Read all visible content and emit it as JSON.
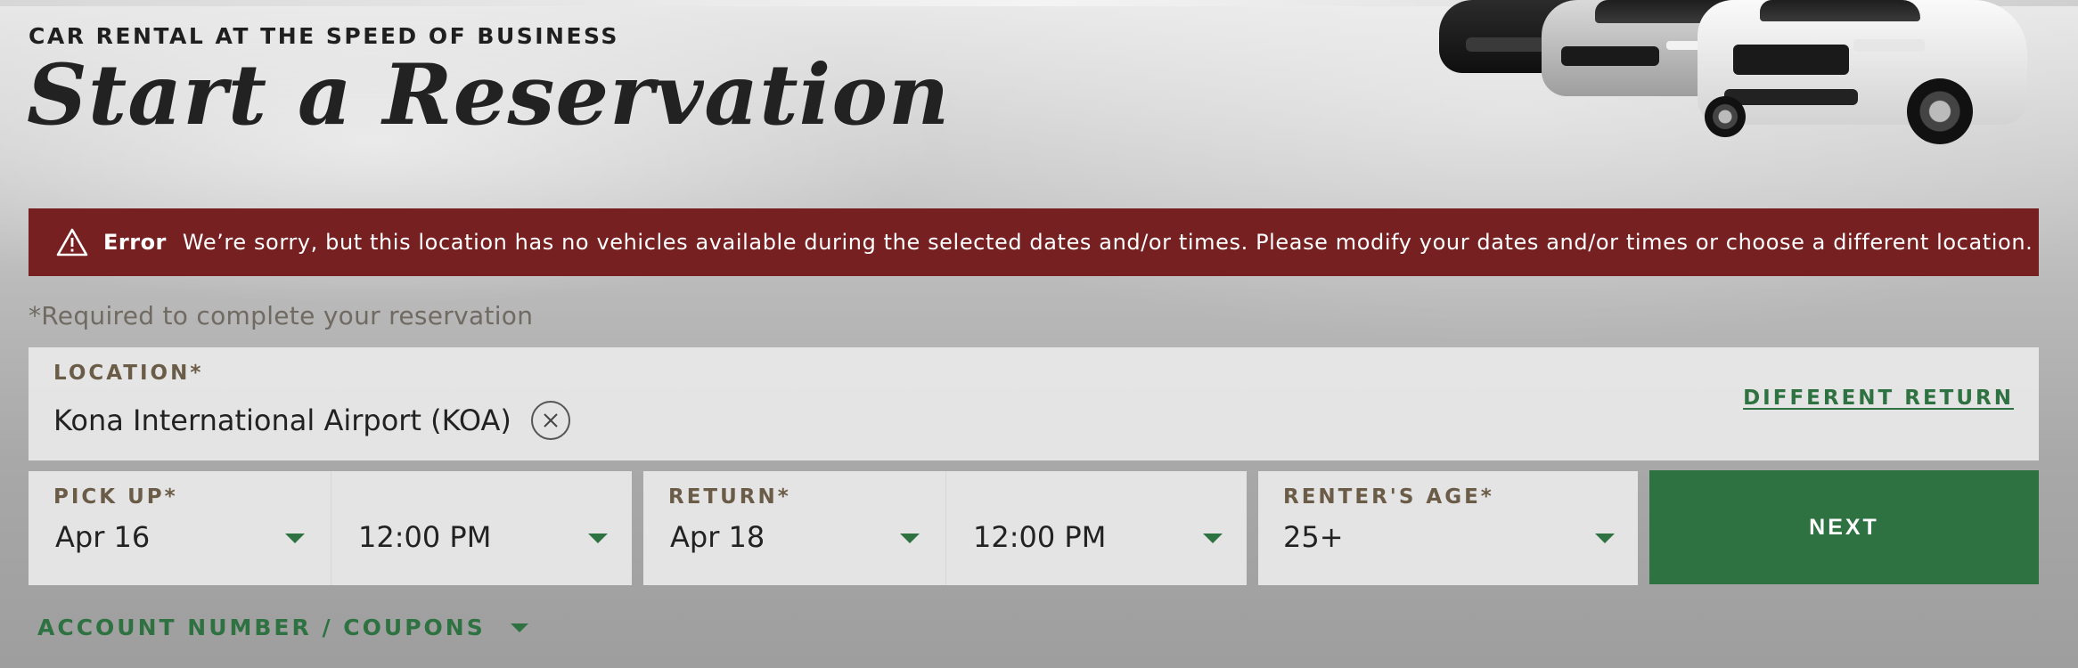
{
  "header": {
    "eyebrow": "CAR RENTAL AT THE SPEED OF BUSINESS",
    "title": "Start a Reservation"
  },
  "error": {
    "label": "Error",
    "message": "We’re sorry, but this location has no vehicles available during the selected dates and/or times. Please modify your dates and/or times or choose a different location.",
    "icon": "warning-triangle-icon",
    "color": "#772021"
  },
  "form": {
    "required_note": "*Required to complete your reservation",
    "location": {
      "label": "LOCATION*",
      "value": "Kona International Airport (KOA)",
      "different_return": "DIFFERENT RETURN"
    },
    "pickup": {
      "label": "PICK UP*",
      "date": "Apr 16",
      "time": "12:00 PM"
    },
    "return": {
      "label": "RETURN*",
      "date": "Apr 18",
      "time": "12:00 PM"
    },
    "renter_age": {
      "label": "RENTER'S AGE*",
      "value": "25+"
    },
    "next_label": "NEXT",
    "coupons_label": "ACCOUNT NUMBER / COUPONS"
  },
  "colors": {
    "accent_green": "#2e7242",
    "label_brown": "#6b5c48",
    "error_red": "#772021"
  }
}
